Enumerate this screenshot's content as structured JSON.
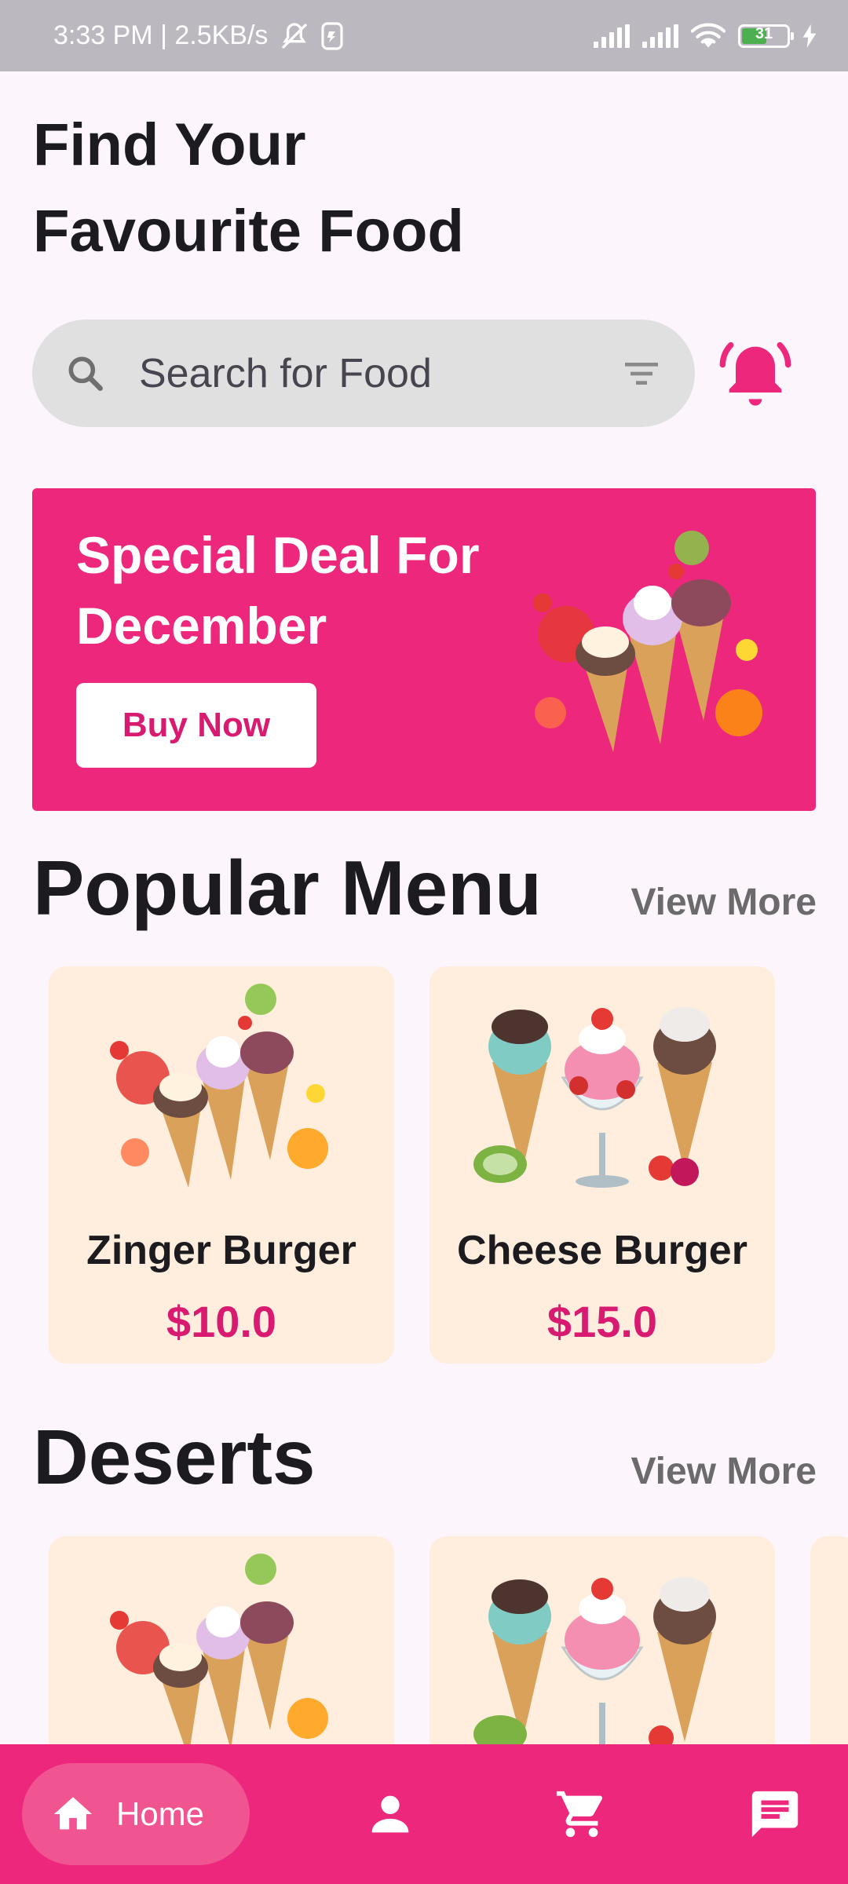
{
  "status_bar": {
    "time_speed": "3:33 PM | 2.5KB/s",
    "battery": "31"
  },
  "header": {
    "title_line1": "Find Your",
    "title_line2": "Favourite Food"
  },
  "search": {
    "placeholder": "Search for Food"
  },
  "banner": {
    "title": "Special Deal For December",
    "button_label": "Buy Now"
  },
  "popular": {
    "title": "Popular Menu",
    "view_more": "View More",
    "items": [
      {
        "name": "Zinger Burger",
        "price": "$10.0"
      },
      {
        "name": "Cheese Burger",
        "price": "$15.0"
      }
    ]
  },
  "deserts": {
    "title": "Deserts",
    "view_more": "View More"
  },
  "bottom_nav": {
    "home_label": "Home",
    "active": "home"
  },
  "colors": {
    "accent": "#ec277c",
    "card_bg": "#ffeedd",
    "price": "#d81b70",
    "background": "#fcf5fc"
  },
  "icons": [
    "search-icon",
    "filter-icon",
    "bell-icon",
    "home-icon",
    "person-icon",
    "cart-icon",
    "chat-icon"
  ]
}
